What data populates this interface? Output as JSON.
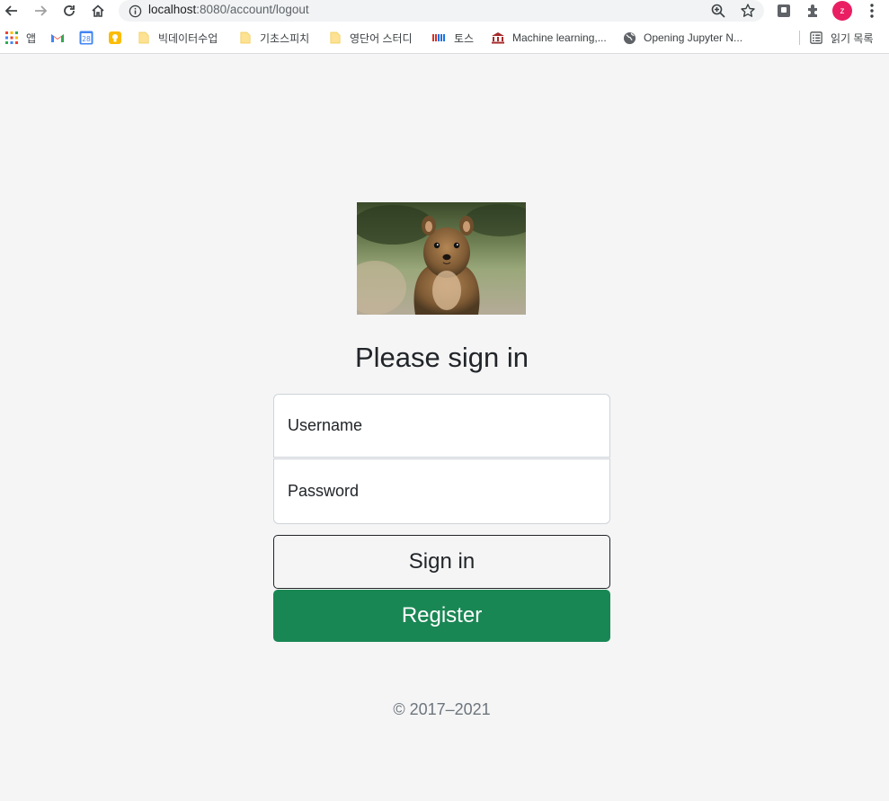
{
  "browser": {
    "url_host": "localhost",
    "url_path": ":8080/account/logout",
    "profile_initial": "z"
  },
  "bookmarks": [
    {
      "label": "앱",
      "icon": "apps-grid-icon"
    },
    {
      "label": "",
      "icon": "gmail-icon"
    },
    {
      "label": "",
      "icon": "calendar-icon"
    },
    {
      "label": "",
      "icon": "keep-icon"
    },
    {
      "label": "빅데이터수업",
      "icon": "folder-icon"
    },
    {
      "label": "기초스피치",
      "icon": "folder-icon"
    },
    {
      "label": "영단어 스터디",
      "icon": "folder-icon"
    },
    {
      "label": "토스",
      "icon": "toss-icon"
    },
    {
      "label": "Machine learning,...",
      "icon": "bank-icon"
    },
    {
      "label": "Opening Jupyter N...",
      "icon": "globe-icon"
    }
  ],
  "reading_list": "읽기 목록",
  "calendar_day": "28",
  "page": {
    "heading": "Please sign in",
    "username_placeholder": "Username",
    "password_placeholder": "Password",
    "signin_label": "Sign in",
    "register_label": "Register",
    "footer": "© 2017–2021"
  },
  "colors": {
    "register_bg": "#198754",
    "page_bg": "#f5f5f5",
    "profile_bg": "#e91e63"
  }
}
